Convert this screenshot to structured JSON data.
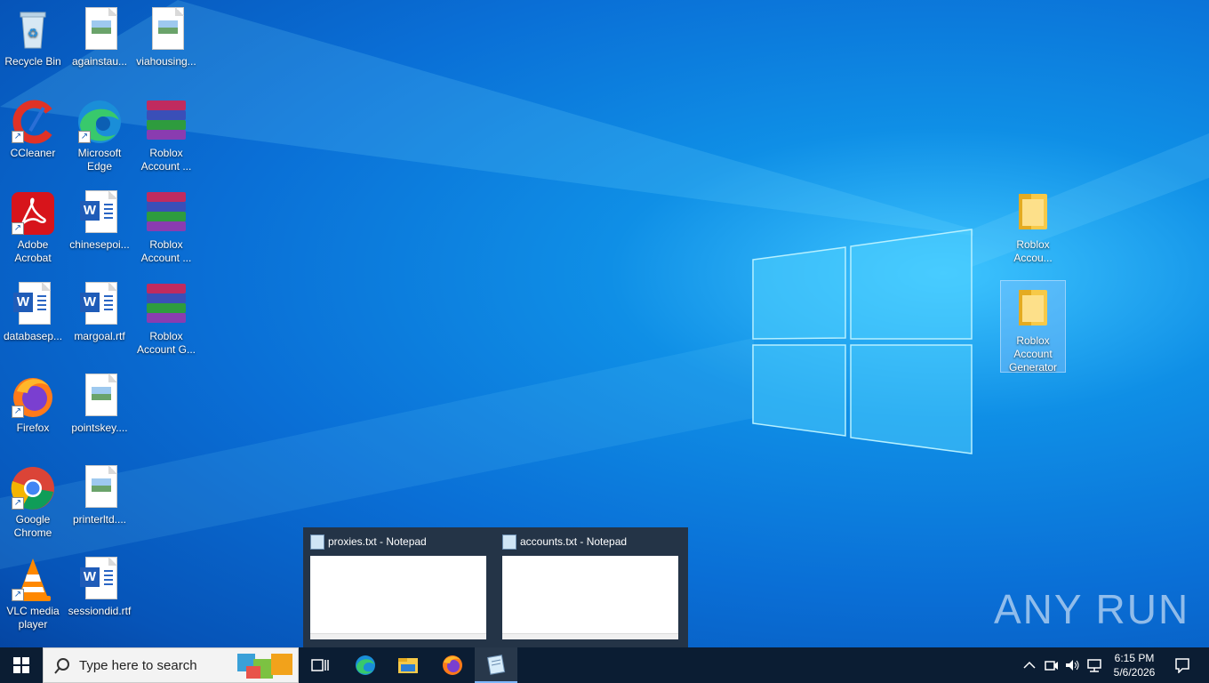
{
  "desktop": {
    "icons": [
      {
        "label": "Recycle Bin"
      },
      {
        "label": "againstau..."
      },
      {
        "label": "viahousing..."
      },
      {
        "label": "CCleaner"
      },
      {
        "label": "Microsoft Edge"
      },
      {
        "label": "Roblox Account ..."
      },
      {
        "label": "Adobe Acrobat"
      },
      {
        "label": "chinesepoi..."
      },
      {
        "label": "Roblox Account ..."
      },
      {
        "label": "databasep..."
      },
      {
        "label": "margoal.rtf"
      },
      {
        "label": "Roblox Account G..."
      },
      {
        "label": "Firefox"
      },
      {
        "label": "pointskey...."
      },
      {
        "label": "Google Chrome"
      },
      {
        "label": "printerltd...."
      },
      {
        "label": "VLC media player"
      },
      {
        "label": "sessiondid.rtf"
      },
      {
        "label": "Roblox Accou..."
      },
      {
        "label": "Roblox Account Generator"
      }
    ]
  },
  "thumbnails": [
    {
      "title": "proxies.txt - Notepad"
    },
    {
      "title": "accounts.txt - Notepad"
    }
  ],
  "taskbar": {
    "search_placeholder": "Type here to search",
    "time": "6:15 PM",
    "date": "5/6/2026"
  },
  "watermark": "ANY RUN"
}
